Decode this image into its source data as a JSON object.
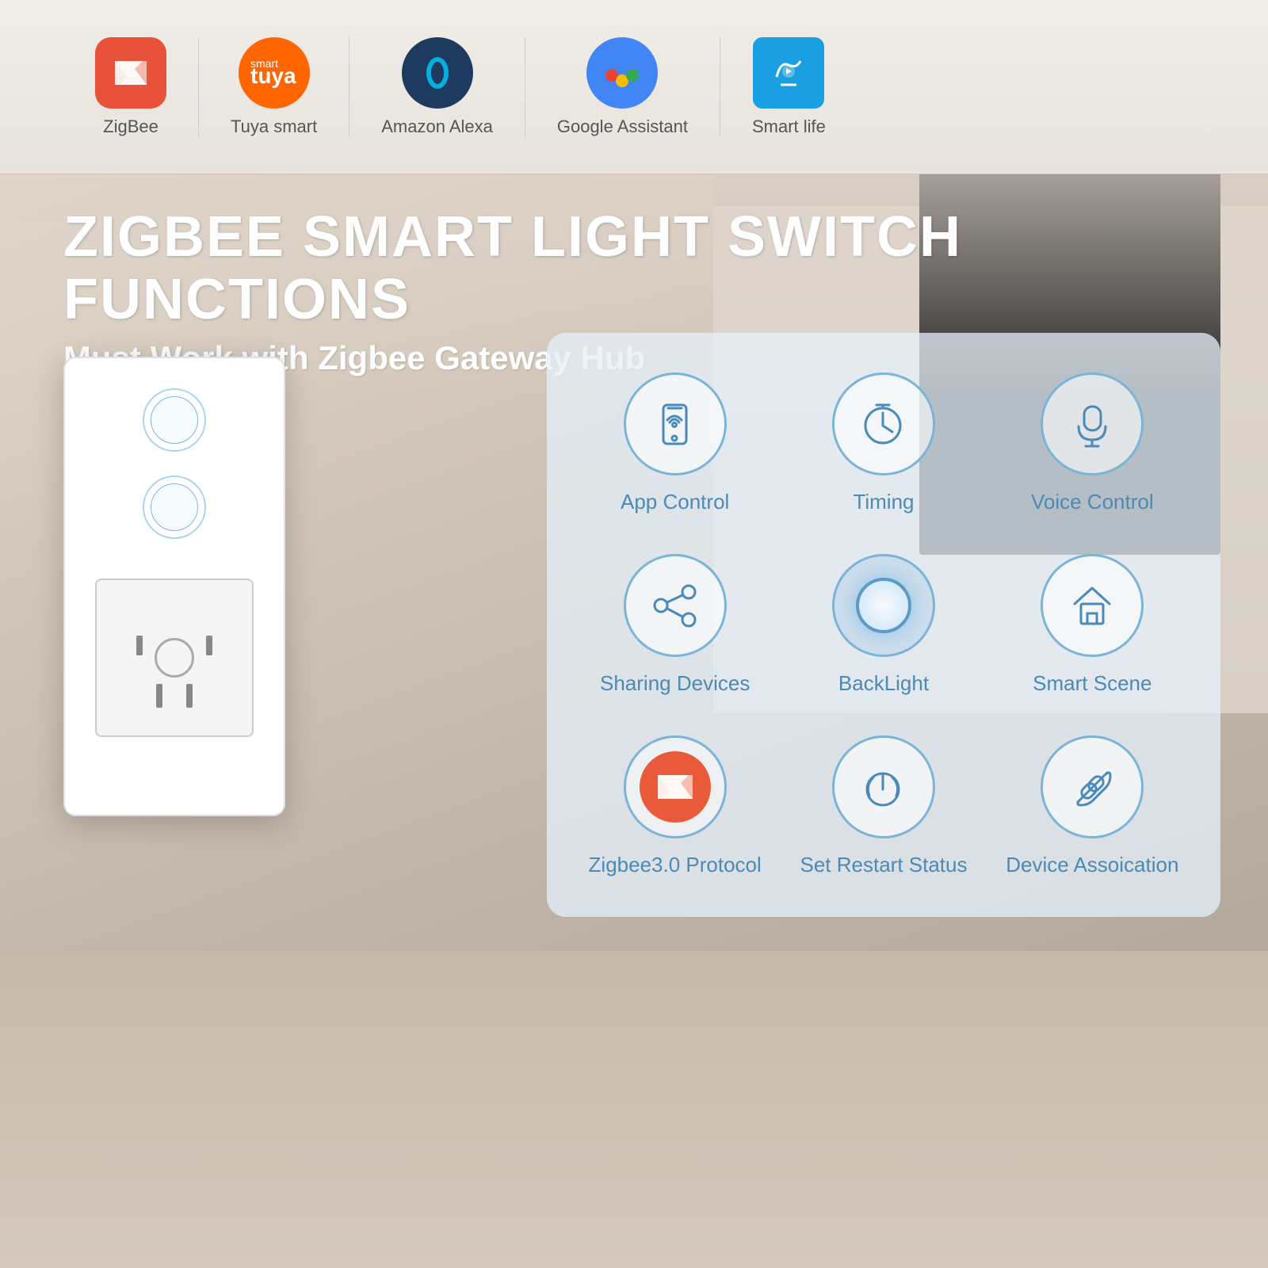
{
  "page": {
    "title": "Zigbee Smart Light Switch Functions"
  },
  "top_bar": {
    "logos": [
      {
        "name": "ZigBee",
        "label": "ZigBee",
        "type": "zigbee"
      },
      {
        "name": "Tuya smart",
        "label": "Tuya smart",
        "type": "tuya"
      },
      {
        "name": "Amazon Alexa",
        "label": "Amazon Alexa",
        "type": "alexa"
      },
      {
        "name": "Google Assistant",
        "label": "Google Assistant",
        "type": "google"
      },
      {
        "name": "Smart life",
        "label": "Smart life",
        "type": "smartlife"
      }
    ]
  },
  "headline": {
    "main": "ZIGBEE SMART LIGHT SWITCH FUNCTIONS",
    "sub": "Must Work with Zigbee Gateway Hub"
  },
  "features": [
    {
      "id": "app-control",
      "label": "App Control",
      "icon": "phone"
    },
    {
      "id": "timing",
      "label": "Timing",
      "icon": "clock"
    },
    {
      "id": "voice-control",
      "label": "Voice Control",
      "icon": "mic"
    },
    {
      "id": "sharing-devices",
      "label": "Sharing  Devices",
      "icon": "share"
    },
    {
      "id": "backlight",
      "label": "BackLight",
      "icon": "backlight"
    },
    {
      "id": "smart-scene",
      "label": "Smart Scene",
      "icon": "home"
    },
    {
      "id": "zigbee-protocol",
      "label": "Zigbee3.0 Protocol",
      "icon": "zigbee"
    },
    {
      "id": "set-restart",
      "label": "Set Restart Status",
      "icon": "power"
    },
    {
      "id": "device-association",
      "label": "Device Assoication",
      "icon": "link"
    }
  ]
}
